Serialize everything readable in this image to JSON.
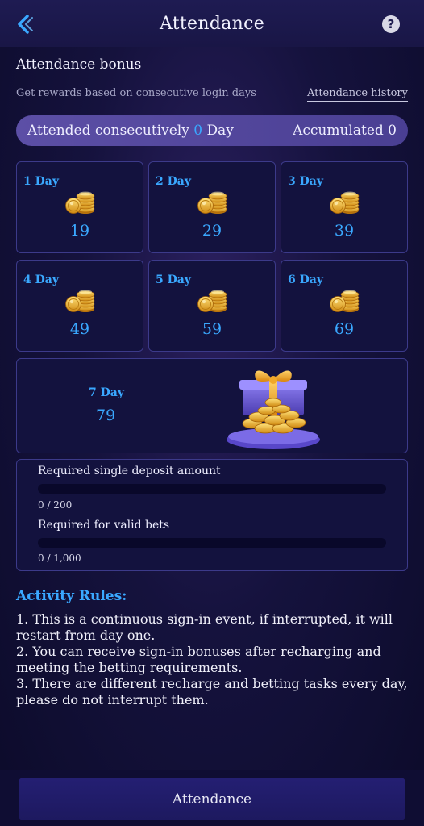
{
  "header": {
    "title": "Attendance",
    "help_label": "?"
  },
  "bonus": {
    "title": "Attendance bonus",
    "subtitle": "Get rewards based on consecutive login days",
    "history_link": "Attendance history"
  },
  "streak": {
    "prefix": "Attended consecutively",
    "count": "0",
    "suffix": "Day",
    "accumulated_label": "Accumulated",
    "accumulated_value": "0"
  },
  "days": [
    {
      "label": "1 Day",
      "amount": "19"
    },
    {
      "label": "2 Day",
      "amount": "29"
    },
    {
      "label": "3 Day",
      "amount": "39"
    },
    {
      "label": "4 Day",
      "amount": "49"
    },
    {
      "label": "5 Day",
      "amount": "59"
    },
    {
      "label": "6 Day",
      "amount": "69"
    },
    {
      "label": "7 Day",
      "amount": "79"
    }
  ],
  "requirements": [
    {
      "label": "Required single deposit amount",
      "value": "0 / 200",
      "progress": 0
    },
    {
      "label": "Required for valid bets",
      "value": "0 / 1,000",
      "progress": 0
    }
  ],
  "rules": {
    "title": "Activity Rules:",
    "items": [
      "1. This is a continuous sign-in event, if interrupted, it will restart from day one.",
      "2. You can receive sign-in bonuses after recharging and meeting the betting requirements.",
      "3. There are different recharge and betting tasks every day, please do not interrupt them."
    ]
  },
  "footer": {
    "button_label": "Attendance"
  },
  "colors": {
    "accent": "#3aa8ff",
    "card_border": "#3c3a8a",
    "card_bg": "#13123e"
  },
  "icons": {
    "back": "back-arrow-icon",
    "help": "help-icon",
    "coins": "coin-stack-icon",
    "gift": "gift-box-icon"
  }
}
